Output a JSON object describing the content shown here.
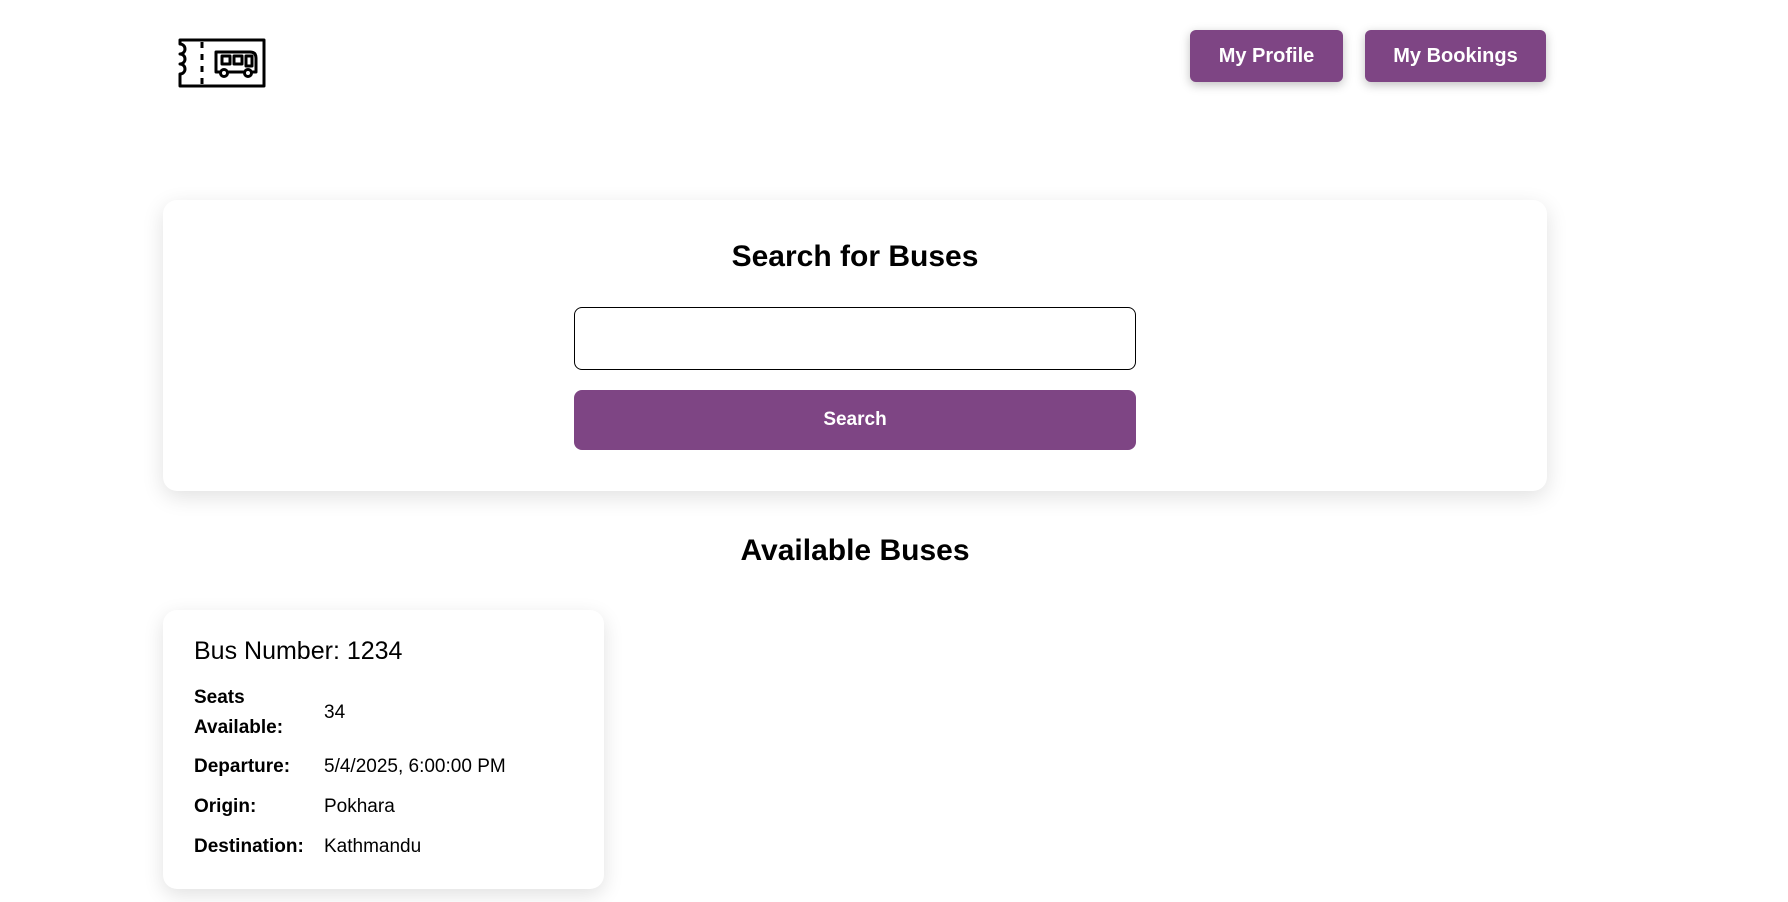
{
  "header": {
    "logo_icon": "bus-ticket-icon",
    "profile_label": "My Profile",
    "bookings_label": "My Bookings"
  },
  "search": {
    "title": "Search for Buses",
    "input_value": "",
    "input_placeholder": "",
    "button_label": "Search"
  },
  "results": {
    "title": "Available Buses",
    "buses": [
      {
        "number_label": "Bus Number:",
        "number": "1234",
        "seats_label": "Seats Available:",
        "seats": "34",
        "departure_label": "Departure:",
        "departure": "5/4/2025, 6:00:00 PM",
        "origin_label": "Origin:",
        "origin": "Pokhara",
        "destination_label": "Destination:",
        "destination": "Kathmandu"
      }
    ]
  },
  "colors": {
    "accent": "#7e4584"
  }
}
